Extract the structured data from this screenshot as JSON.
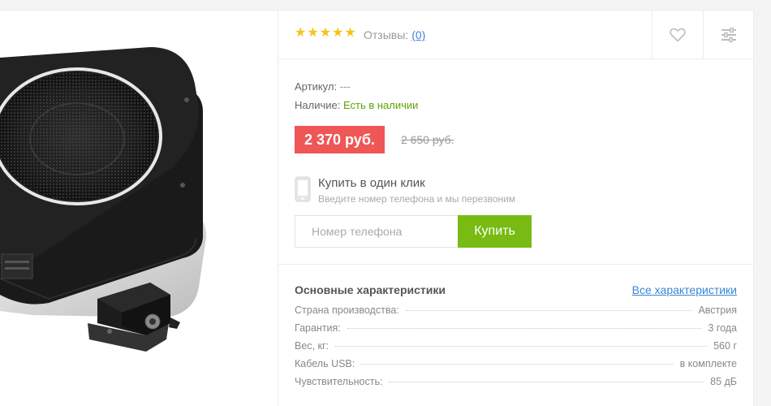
{
  "rating": {
    "stars": 5,
    "filled": 5
  },
  "reviews": {
    "label": "Отзывы:",
    "count": "(0)"
  },
  "icons": {
    "favorite": "heart-icon",
    "compare": "sliders-icon",
    "phone": "smartphone-icon"
  },
  "details": {
    "sku_label": "Артикул:",
    "sku_value": "---",
    "stock_label": "Наличие:",
    "stock_value": "Есть в наличии"
  },
  "price": {
    "current": "2 370 руб.",
    "old": "2 650 руб."
  },
  "one_click": {
    "title": "Купить в один клик",
    "subtitle": "Введите номер телефона и мы перезвоним",
    "placeholder": "Номер телефона",
    "button": "Купить"
  },
  "specs": {
    "title": "Основные характеристики",
    "all_link": "Все характеристики",
    "rows": [
      {
        "name": "Страна производства:",
        "value": "Австрия"
      },
      {
        "name": "Гарантия:",
        "value": "3 года"
      },
      {
        "name": "Вес, кг:",
        "value": "560 г"
      },
      {
        "name": "Кабель USB:",
        "value": "в комплекте"
      },
      {
        "name": "Чувствительность:",
        "value": "85 дБ"
      }
    ]
  },
  "colors": {
    "price_bg": "#ef5656",
    "buy_bg": "#77bb13",
    "in_stock": "#5ca400",
    "link": "#3a86d4",
    "star": "#f7c21b"
  }
}
